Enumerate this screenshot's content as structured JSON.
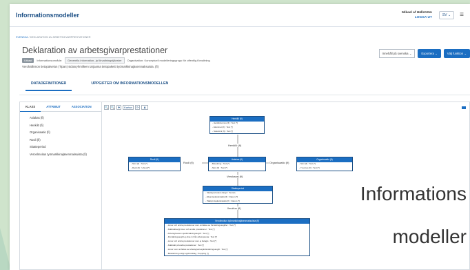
{
  "app": {
    "title": "Informationsmodeller"
  },
  "user": {
    "name": "Mikael af Hällström",
    "logout": "LOGGA UT",
    "language": "SV"
  },
  "breadcrumb": {
    "home": "SVENSKA",
    "separator": "/",
    "current": "DEKLARATION AV ARBETSGIVARPRESTATIONER"
  },
  "page": {
    "title": "Deklaration av arbetsgivarprestationer",
    "status": "Utkast",
    "domain_label": "Informationsområde:",
    "domain_value": "Generella information- ja förvaltningstjänster",
    "org_label": "Organisation:",
    "org_value": "Konceptuell modelleringsgrupp för offentlig förvaltning",
    "description": "Verohallinnon tietopalvelun (Tipan) sidosryhmilleen tarjoama tietopaketti työmarkkinajäsenmaksuista. (fi)"
  },
  "actions": {
    "content_language": "Innehåll på svenska",
    "export": "Exportera",
    "functions": "Välj funktion"
  },
  "tabs": [
    {
      "label": "DATADEFINITIONER",
      "active": true
    },
    {
      "label": "UPPGIFTER OM INFORMATIONSMODELLEN",
      "active": false
    }
  ],
  "sidebar": {
    "tabs": [
      "KLASS",
      "ATTRIBUT",
      "ASSOCIATION"
    ],
    "items": [
      "Asiakas (fi)",
      "Henkilö (fi)",
      "Organisaatio (fi)",
      "Rooli (fi)",
      "Skatteperiod",
      "Veronlmoitus työmarkkinajäsenmaksuista (fi)"
    ]
  },
  "toolbar": {
    "zoom_in": "+",
    "zoom_out": "−",
    "fit": "✥",
    "layout": "Kartan",
    "refresh": "⟳",
    "person": "♟"
  },
  "diagram": {
    "entities": [
      {
        "title": "Henkilö (fi)",
        "attrs": [
          "- Henkilötunnus (fi) : Text [*]",
          "- Etunimet (fi) : Text [*]",
          "- Sukunimi (fi) : Text [*]"
        ]
      },
      {
        "title": "Rooli (fi)",
        "attrs": [
          "- Nimi (fi) : Text [*]",
          "- Rooli (fi) : Urkod [*]"
        ]
      },
      {
        "title": "Asiakas (fi)",
        "attrs": [
          "- Betedning : Text [*]",
          "- Nimi (fi) : Text [*]"
        ]
      },
      {
        "title": "Organisaatio (fi)",
        "attrs": [
          "- Nimi (fi) : Text [*]",
          "- Y-tunnus (fi) : Text [*]"
        ]
      },
      {
        "title": "Skatteperiod",
        "attrs": [
          "- Skatteperiodens längd : Text [*]",
          "- Alkamispäivämäärä (fi) : Datum [*]",
          "- Päättymispäivämäärä (fi) : Datum [*]"
        ]
      },
      {
        "title": "Veroilmoitus työmarkkinajäsenmaksuista (fi)",
        "attrs": [
          "- Löner och andra prestationer som omfattas av försäkringsavgifter : Text [*]",
          "- Kalkisättavigt löner och andra prestationer : Text [*]",
          "- Arbetsgivarens sjukförsäkringsavgift : Text [*]",
          "- Försäkringsavgift ej dras in från arbetspresta : Text [*]",
          "- Löner och andra prestationer som ej belagts : Text [*]",
          "- Kalkisätt på andra prestationer : Text [*]",
          "- Löner som omfattas av arbetsgivaresjukförsäkringsavgift : Text [*]",
          "- Beskattning enligt uppbördslag : Koppling [*]"
        ]
      }
    ],
    "relations": {
      "person": "Henkilö (fi)",
      "role": "Rooli (fi)",
      "org": "Organisaatio (fi)",
      "customer": "Verokausi (fi)",
      "report": "Ilmoitus (fi)"
    }
  },
  "watermark": {
    "line1": "Informations",
    "line2": "modeller"
  }
}
